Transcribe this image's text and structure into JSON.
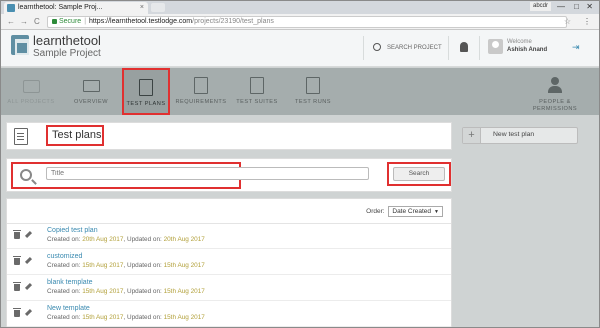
{
  "browser": {
    "tab_title": "learnthetool: Sample Proj...",
    "tab_close": "×",
    "window_user": "abcdr",
    "minimize": "—",
    "maximize": "□",
    "close": "✕",
    "back": "←",
    "forward": "→",
    "reload": "C",
    "secure_label": "Secure",
    "url_host": "https://learnthetool.testlodge.com",
    "url_path": "/projects/23190/test_plans",
    "star": "☆",
    "menu": "⋮"
  },
  "header": {
    "app_name": "learnthetool",
    "project_name": "Sample Project",
    "search_label": "SEARCH PROJECT",
    "welcome": "Welcome",
    "username": "Ashish Anand",
    "logout_glyph": "⇥"
  },
  "nav": {
    "items": [
      {
        "label": "ALL PROJECTS"
      },
      {
        "label": "OVERVIEW"
      },
      {
        "label": "TEST PLANS"
      },
      {
        "label": "REQUIREMENTS"
      },
      {
        "label": "TEST SUITES"
      },
      {
        "label": "TEST RUNS"
      },
      {
        "label": "PEOPLE &",
        "label2": "PERMISSIONS"
      }
    ]
  },
  "page": {
    "title": "Test plans",
    "search_placeholder": "Title",
    "search_button": "Search",
    "order_label": "Order:",
    "order_value": "Date Created",
    "new_plan_label": "New test plan",
    "new_plan_plus": "+"
  },
  "plans": [
    {
      "name": "Copied test plan",
      "created_label": "Created on:",
      "created": "20th Aug 2017",
      "updated_label": ", Updated on:",
      "updated": "20th Aug 2017"
    },
    {
      "name": "customized",
      "created_label": "Created on:",
      "created": "15th Aug 2017",
      "updated_label": ", Updated on:",
      "updated": "15th Aug 2017"
    },
    {
      "name": "blank template",
      "created_label": "Created on:",
      "created": "15th Aug 2017",
      "updated_label": ", Updated on:",
      "updated": "15th Aug 2017"
    },
    {
      "name": "New template",
      "created_label": "Created on:",
      "created": "15th Aug 2017",
      "updated_label": ", Updated on:",
      "updated": "15th Aug 2017"
    }
  ],
  "colors": {
    "highlight": "#e03030",
    "link": "#3a8ab0",
    "date": "#b2a03a",
    "nav_bg": "#a5adad"
  }
}
